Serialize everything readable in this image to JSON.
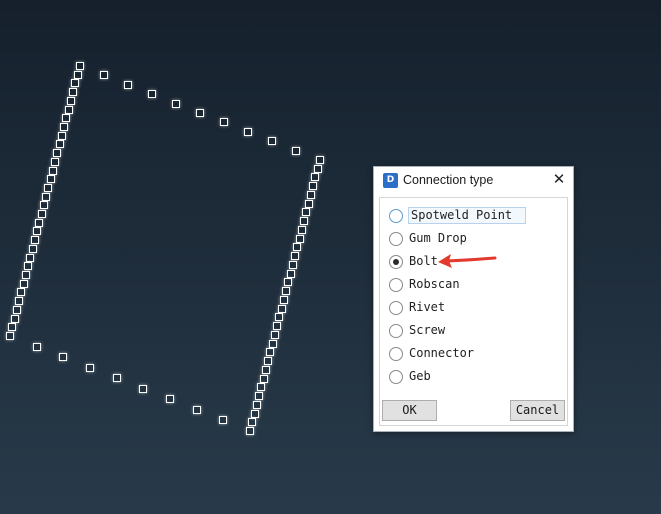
{
  "viewport": {
    "background_top": "#15202c",
    "background_bottom": "#283a4a",
    "point_color": "#ffffff"
  },
  "dialog": {
    "title": "Connection type",
    "app_icon_glyph": "D",
    "close_glyph": "✕",
    "options": [
      "Spotweld Point",
      "Gum Drop",
      "Bolt",
      "Robscan",
      "Rivet",
      "Screw",
      "Connector",
      "Geb"
    ],
    "selected": "Bolt",
    "focused": "Spotweld Point",
    "ok_label": "OK",
    "cancel_label": "Cancel"
  },
  "annotation": {
    "arrow_color": "#e23b2e",
    "points_to": "Bolt"
  }
}
